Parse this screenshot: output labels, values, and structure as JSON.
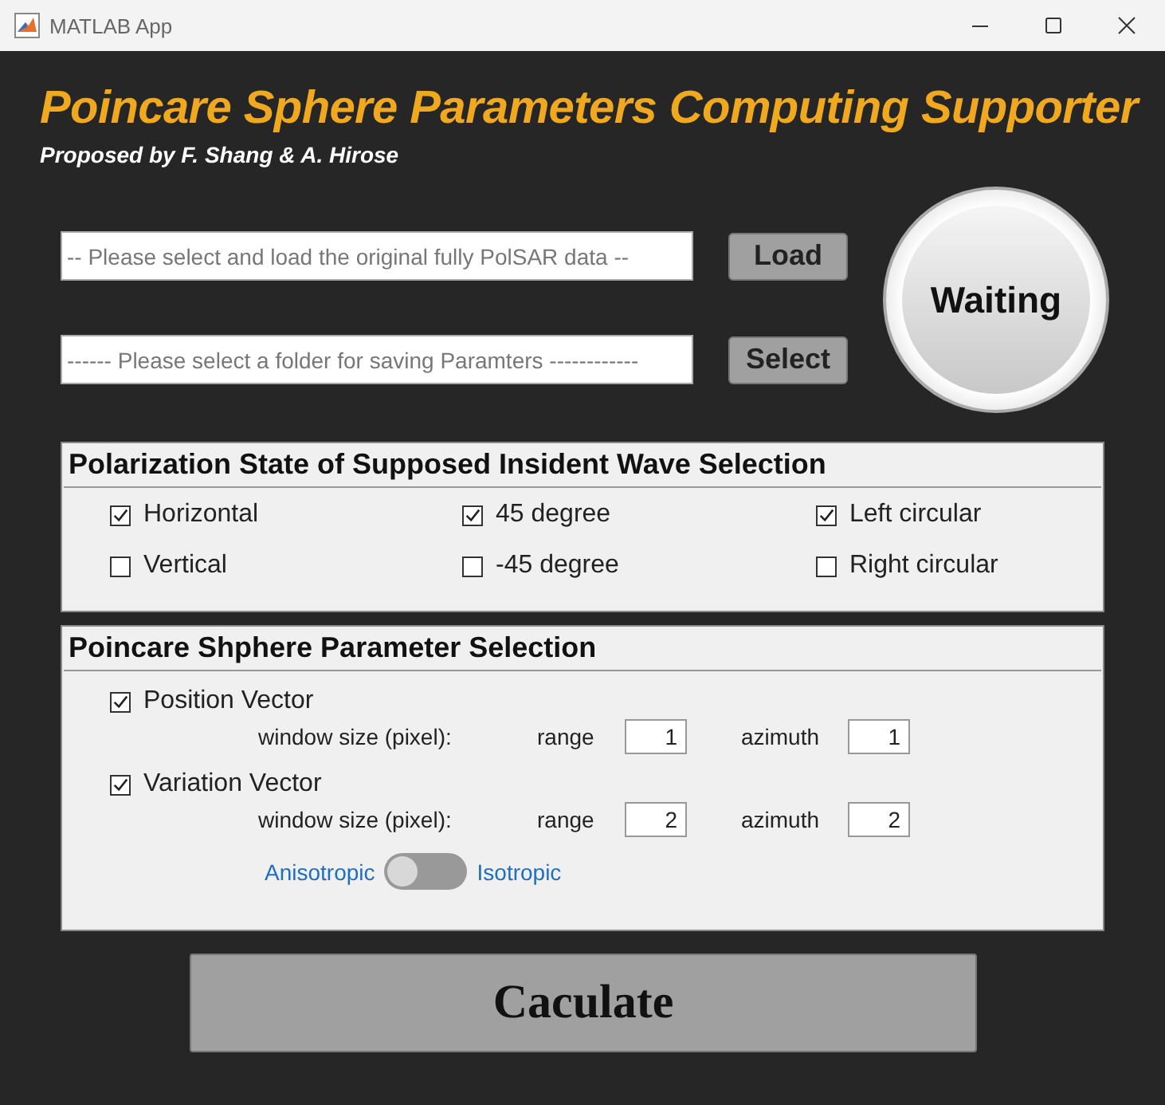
{
  "window": {
    "title": "MATLAB App"
  },
  "header": {
    "title": "Poincare Sphere Parameters Computing Supporter",
    "subtitle": "Proposed by F. Shang & A. Hirose"
  },
  "inputs": [
    {
      "placeholder": "-- Please select and load the original fully PolSAR data --",
      "button": "Load"
    },
    {
      "placeholder": "------ Please select a folder for saving Paramters ------------",
      "button": "Select"
    }
  ],
  "status_lamp": {
    "label": "Waiting"
  },
  "polarization_panel": {
    "title": "Polarization State of Supposed Insident Wave Selection",
    "options": [
      {
        "label": "Horizontal",
        "checked": true
      },
      {
        "label": "45 degree",
        "checked": true
      },
      {
        "label": "Left circular",
        "checked": true
      },
      {
        "label": "Vertical",
        "checked": false
      },
      {
        "label": "-45 degree",
        "checked": false
      },
      {
        "label": "Right circular",
        "checked": false
      }
    ]
  },
  "parameter_panel": {
    "title": "Poincare Shphere Parameter Selection",
    "parameters": [
      {
        "label": "Position Vector",
        "checked": true,
        "window_label": "window size (pixel):",
        "range_label": "range",
        "range": "1",
        "azimuth_label": "azimuth",
        "azimuth": "1"
      },
      {
        "label": "Variation Vector",
        "checked": true,
        "window_label": "window size (pixel):",
        "range_label": "range",
        "range": "2",
        "azimuth_label": "azimuth",
        "azimuth": "2"
      }
    ],
    "switch": {
      "left_label": "Anisotropic",
      "right_label": "Isotropic",
      "on": false
    }
  },
  "calculate_button": "Caculate"
}
